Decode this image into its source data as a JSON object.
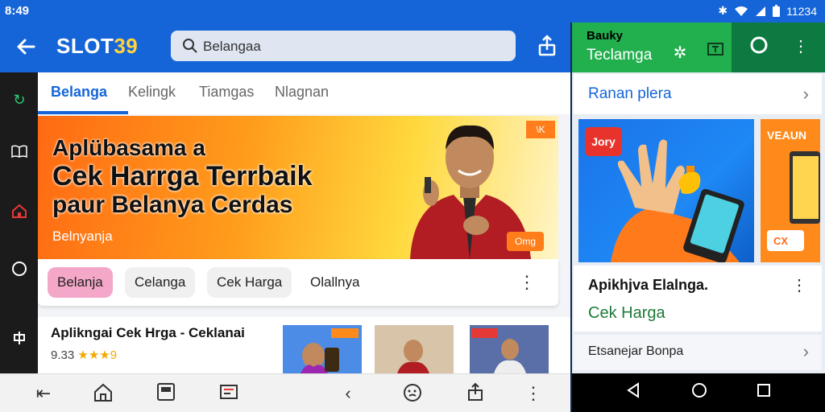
{
  "status_bar": {
    "time": "8:49",
    "clock_right": "11234"
  },
  "left_app": {
    "brand_primary": "SLOT",
    "brand_accent": "39",
    "search_value": "Belangaa",
    "tabs": [
      "Belanga",
      "Kelingk",
      "Tiamgas",
      "Nlagnan"
    ],
    "banner": {
      "line1": "Aplübasama a",
      "line2": "Cek Harrga Terrbaik",
      "line3": "paur Belanya Cerdas",
      "tag": "Belnyanja",
      "corner_badge": "\\K",
      "price_pill": "Omg"
    },
    "chips": [
      "Belanja",
      "Celanga",
      "Cek Harga",
      "Olallnya"
    ],
    "listing": {
      "title": "Aplikngai Cek Hrga - Ceklanai",
      "rating_value": "9.33",
      "rating_stars": "★★★9"
    },
    "thumb_badge": "ONNNA",
    "thumb_badge2": "EONNA"
  },
  "right_app": {
    "header_line1": "Bauky",
    "header_line2": "Teclamga",
    "row1_label": "Ranan plera",
    "card1_logo": "Jory",
    "card2_label": "VEAUN",
    "card2_pill": "CX",
    "info_title": "Apikhjva Elalnga.",
    "info_sub": "Cek Harga",
    "row3_label": "Etsanejar Bonpa"
  },
  "colors": {
    "primary": "#1565d8",
    "brand_yellow": "#ffd23f",
    "right_header": "#22b04f",
    "right_header_dark": "#0c7a41",
    "active_chip": "#f4a7c9"
  }
}
